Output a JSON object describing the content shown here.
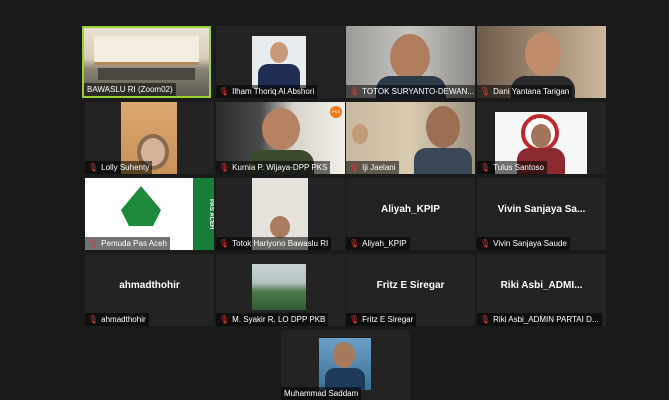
{
  "colors": {
    "active_border": "#9ad232",
    "muted_icon": "#e53935",
    "tile_bg": "#232323"
  },
  "icons": {
    "muted": "muted-mic-icon"
  },
  "participants": [
    {
      "name": "BAWASLU RI (Zoom02)",
      "muted": false
    },
    {
      "name": "Ilham Thoriq Al Abshori",
      "muted": true
    },
    {
      "name": "TOTOK SURYANTO-DEWAN...",
      "muted": true
    },
    {
      "name": "Dani Yantana Tarigan",
      "muted": true
    },
    {
      "name": "Lolly Suhenty",
      "muted": true
    },
    {
      "name": "Kurnia P. Wijaya-DPP PKS",
      "muted": true
    },
    {
      "name": "Iji Jaelani",
      "muted": true
    },
    {
      "name": "Tulus Santoso",
      "muted": true
    },
    {
      "name": "Pemuda Pas Aceh",
      "muted": true
    },
    {
      "name": "Totok Hariyono Bawaslu RI",
      "muted": true
    },
    {
      "name": "Aliyah_KPIP",
      "display": "Aliyah_KPIP",
      "muted": true
    },
    {
      "name": "Vivin Sanjaya Saude",
      "display": "Vivin Sanjaya Sa...",
      "muted": true
    },
    {
      "name": "ahmadthohir",
      "display": "ahmadthohir",
      "muted": true
    },
    {
      "name": "M. Syakir R. LO DPP PKB",
      "muted": true
    },
    {
      "name": "Fritz E Siregar",
      "display": "Fritz E Siregar",
      "muted": true
    },
    {
      "name": "Riki Asbi_ADMIN PARTAI D...",
      "display": "Riki Asbi_ADMI...",
      "muted": true
    },
    {
      "name": "Muhammad Saddam",
      "muted": false
    }
  ],
  "pas_aceh_side": "PAS ACEH",
  "pks_logo": "PKS"
}
